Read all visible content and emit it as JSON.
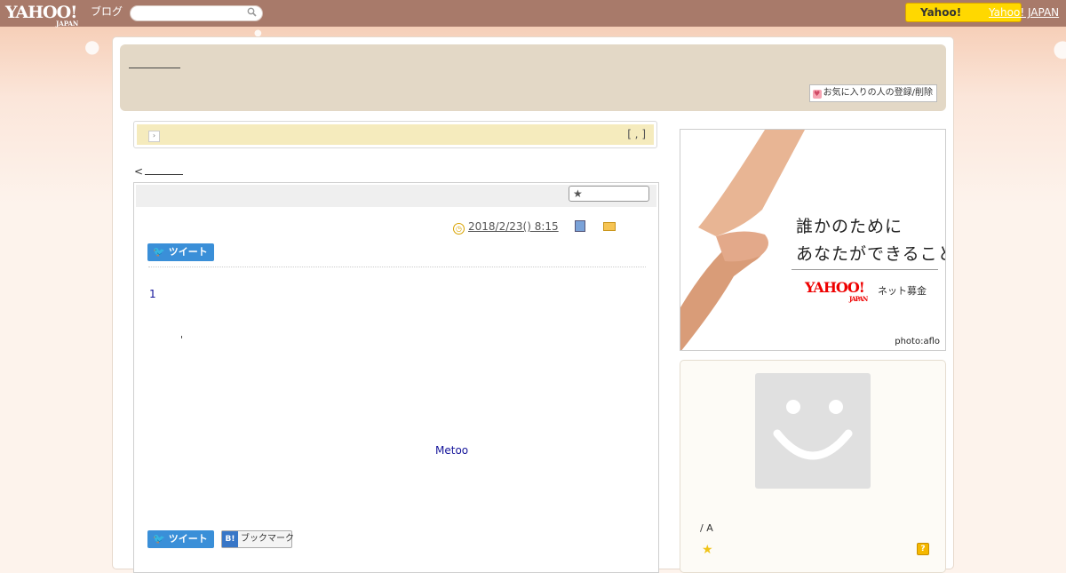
{
  "topbar": {
    "logo_text": "YAHOO!",
    "logo_sub": "JAPAN",
    "blog_label": "ブログ",
    "search_placeholder": "",
    "yahoo_button_label": "Yahoo!",
    "yahoo_japan_link": "Yahoo! JAPAN"
  },
  "header": {
    "favorite_button_label": "お気に入りの人の登録/削除"
  },
  "notice": {
    "links_text": "[ , ]"
  },
  "nav": {
    "prev_label": "<"
  },
  "article": {
    "datetime": "2018/2/23()  8:15",
    "tweet_label": "ツイート",
    "body_line_1": "1",
    "body_line_2": "'",
    "body_line_3": "Metoo",
    "bottom_tweet_label": "ツイート",
    "bookmark_label": "ブックマーク",
    "bookmark_badge": "B!"
  },
  "sidebar": {
    "ad": {
      "line1": "誰かのために",
      "line2": "あなたができること",
      "logo": "YAHOO!",
      "logo_sub": "JAPAN",
      "service": "ネット募金",
      "credit": "photo:aflo"
    },
    "profile": {
      "name": "/ A"
    }
  },
  "colors": {
    "topbar": "#a87a6a",
    "header": "#e3d8c6",
    "notice": "#f5ebbd",
    "tweet": "#3a8fd8",
    "link_blue": "#14149a",
    "yahoo_yellow": "#ffd800"
  },
  "icons": [
    "search-icon",
    "heart-icon",
    "arrow-icon",
    "star-icon",
    "clock-icon",
    "book-icon",
    "folder-icon",
    "twitter-icon",
    "question-icon"
  ]
}
